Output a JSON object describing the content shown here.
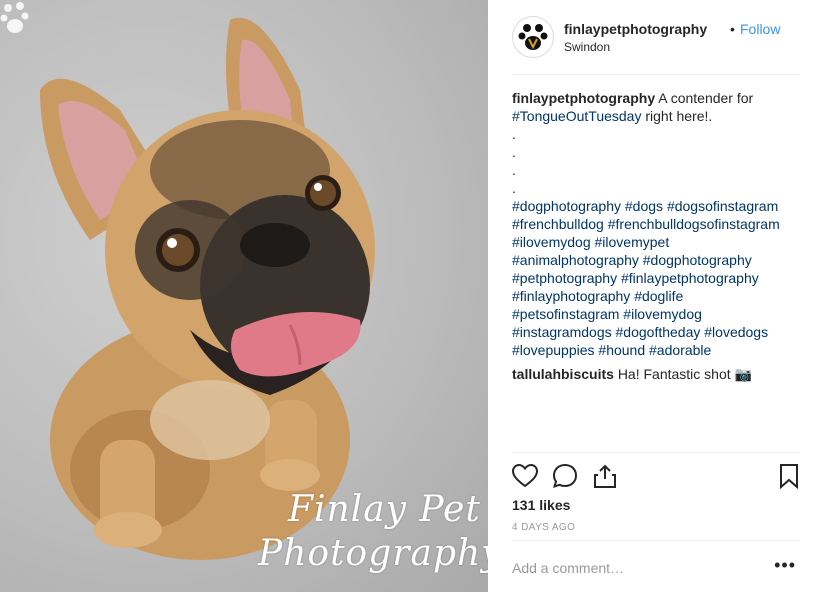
{
  "post": {
    "username": "finlaypetphotography",
    "separator": "•",
    "follow_label": "Follow",
    "location": "Swindon",
    "caption_username": "finlaypetphotography",
    "caption_text_1": " A contender for",
    "caption_tag_1": "#TongueOutTuesday",
    "caption_text_2": " right here!.",
    "dots": [
      ".",
      ".",
      ".",
      "."
    ],
    "hashtag_lines": [
      [
        "#dogphotography",
        "#dogs",
        "#dogsofinstagram"
      ],
      [
        "#frenchbulldog",
        "#frenchbulldogsofinstagram"
      ],
      [
        "#ilovemydog",
        "#ilovemypet"
      ],
      [
        "#animalphotography",
        "#dogphotography"
      ],
      [
        "#petphotography",
        "#finlaypetphotography"
      ],
      [
        "#finlayphotography",
        "#doglife"
      ],
      [
        "#petsofinstagram",
        "#ilovemydog"
      ],
      [
        "#instagramdogs",
        "#dogoftheday",
        "#lovedogs"
      ],
      [
        "#lovepuppies",
        "#hound",
        "#adorable"
      ]
    ],
    "comment_username": "tallulahbiscuits",
    "comment_text": "Ha! Fantastic shot",
    "comment_icon": "camera-emoji",
    "likes": "131 likes",
    "time_ago": "4 DAYS AGO",
    "comment_placeholder": "Add a comment…",
    "more_label": "•••",
    "watermark_line1": "Finlay Pet",
    "watermark_line2": "Photography"
  },
  "icons": {
    "like": "heart-icon",
    "comment": "comment-icon",
    "share": "share-icon",
    "save": "bookmark-icon"
  }
}
